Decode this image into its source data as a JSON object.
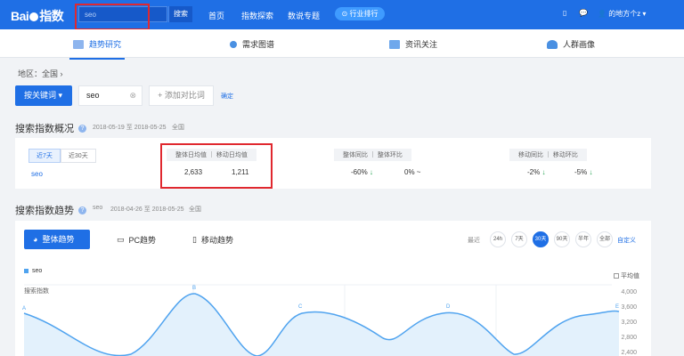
{
  "brand": {
    "logo_text": "Bai",
    "logo_text2": "指数"
  },
  "top_search": {
    "value": "seo",
    "button": "搜索"
  },
  "top_nav": [
    "首页",
    "指数探索",
    "数说专题"
  ],
  "rank_button": "⊙ 行业排行",
  "user": {
    "name": "的地方个z ▾"
  },
  "subnav": [
    {
      "label": "趋势研究",
      "color": "#1f6fe5"
    },
    {
      "label": "需求图谱",
      "color": "#1f6fe5"
    },
    {
      "label": "资讯关注",
      "color": "#4a90e2"
    },
    {
      "label": "人群画像",
      "color": "#4a90e2"
    }
  ],
  "breadcrumb": "地区：全国 ›",
  "keyword_bar": {
    "by_keyword": "按关键词 ▾",
    "keyword": "seo",
    "add_compare": "+ 添加对比词",
    "confirm": "确定"
  },
  "overview": {
    "title": "搜索指数概况",
    "range": "2018-05-19 至 2018-05-25",
    "region": "全国",
    "periods": [
      "近7天",
      "近30天"
    ],
    "keyword": "seo",
    "headers": [
      "整体日均值 ｜ 移动日均值",
      "整体同比 ｜ 整体环比",
      "移动同比 ｜ 移动环比"
    ],
    "values": {
      "overall_avg": "2,633",
      "mobile_avg": "1,211",
      "overall_yoy": "-60%",
      "overall_mom": "0%",
      "mobile_yoy": "-2%",
      "mobile_mom": "-5%"
    }
  },
  "trend": {
    "title": "搜索指数趋势",
    "keyword": "seo",
    "range": "2018-04-26 至 2018-05-25",
    "region": "全国",
    "tabs": [
      "整体趋势",
      "PC趋势",
      "移动趋势"
    ],
    "recent_label": "最近",
    "ranges": [
      "24h",
      "7天",
      "30天",
      "90天",
      "半年",
      "全部"
    ],
    "active_range": "30天",
    "custom": "自定义",
    "legend": "seo",
    "ylabel": "搜索指数",
    "avg_label": "平均值",
    "y_ticks": [
      "4,000",
      "3,600",
      "3,200",
      "2,800",
      "2,400"
    ],
    "markers": [
      "A",
      "B",
      "C",
      "D",
      "E"
    ]
  }
}
